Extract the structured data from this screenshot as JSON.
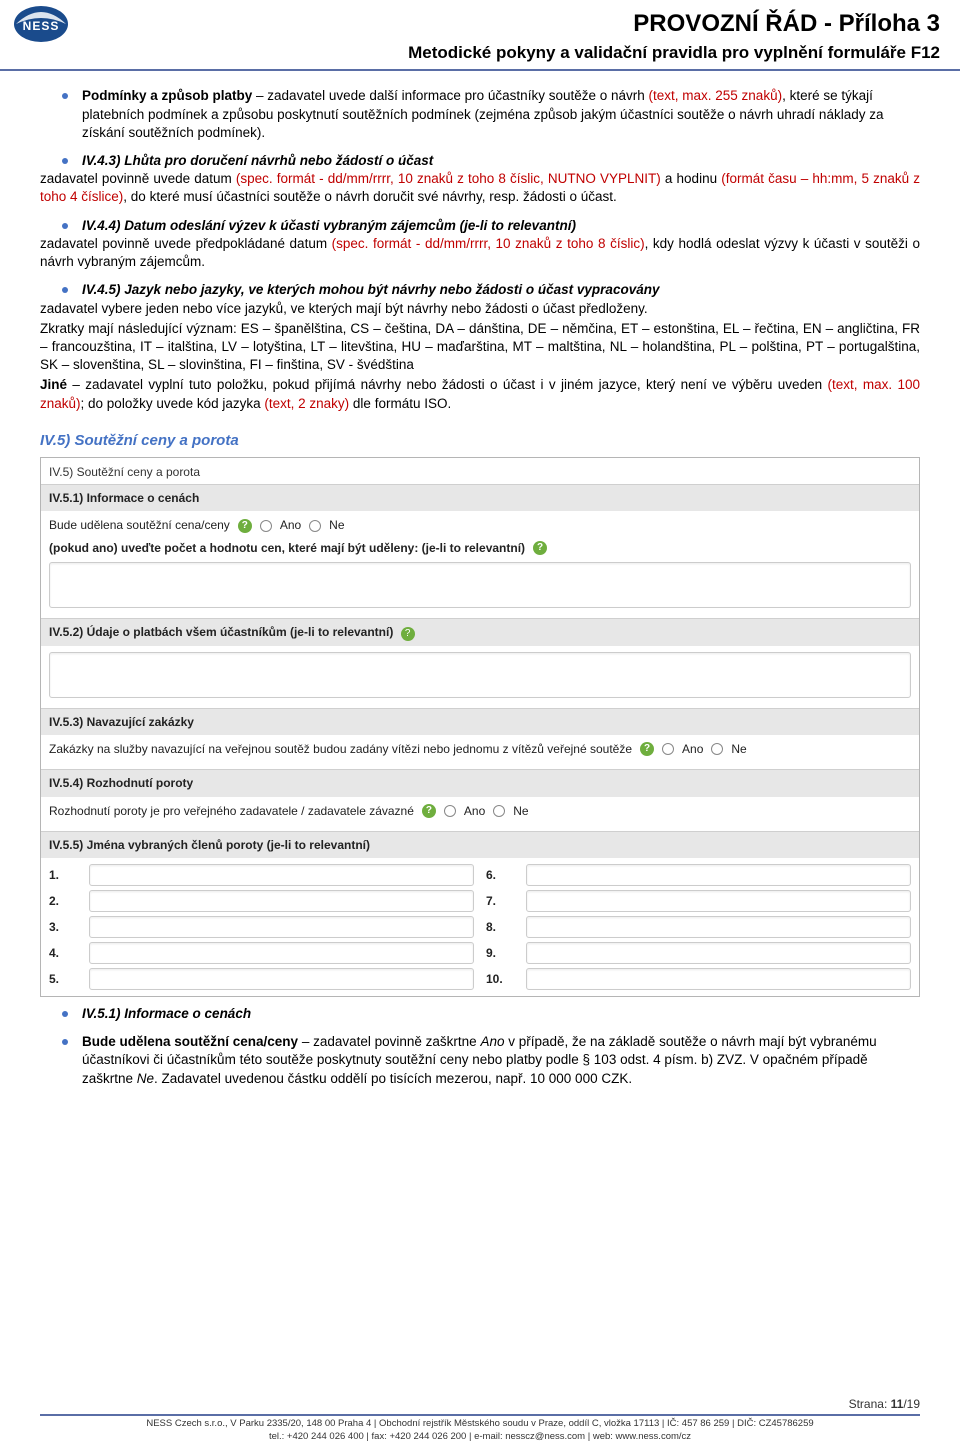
{
  "header": {
    "title": "PROVOZNÍ ŘÁD - Příloha 3",
    "subtitle": "Metodické pokyny a validační pravidla pro vyplnění formuláře F12"
  },
  "bullets_top": [
    {
      "head": "Podmínky a způsob platby",
      "text1": " – zadavatel uvede další informace pro účastníky soutěže o návrh ",
      "red1": "(text, max. 255 znaků)",
      "text2": ", které se týkají platebních podmínek a způsobu poskytnutí soutěžních podmínek (zejména způsob jakým účastníci soutěže o návrh uhradí náklady za získání soutěžních podmínek)."
    },
    {
      "head": "IV.4.3) Lhůta pro doručení návrhů nebo žádostí o účast",
      "plain1": "zadavatel povinně uvede datum ",
      "red1": "(spec. formát - dd/mm/rrrr, 10 znaků z toho 8 číslic, NUTNO VYPLNIT)",
      "plain2": " a hodinu ",
      "red2": "(formát času – hh:mm, 5 znaků z toho 4 číslice)",
      "plain3": ", do které musí účastníci soutěže o návrh doručit své návrhy, resp. žádosti o účast."
    },
    {
      "head": "IV.4.4) Datum odeslání výzev k účasti vybraným zájemcům (je-li to relevantní)",
      "plain1": "zadavatel povinně uvede předpokládané datum ",
      "red1": "(spec. formát - dd/mm/rrrr, 10 znaků z toho 8  číslic)",
      "plain2": ", kdy hodlá odeslat výzvy k účasti v soutěži o návrh vybraným zájemcům."
    },
    {
      "head": "IV.4.5) Jazyk nebo jazyky, ve kterých mohou být návrhy nebo žádosti o účast vypracovány",
      "plain1": "zadavatel vybere jeden nebo více jazyků, ve kterých mají být návrhy nebo žádosti o účast předloženy.",
      "plain2": "Zkratky mají následující význam: ES – španělština, CS – čeština, DA – dánština, DE – němčina, ET – estonština, EL – řečtina, EN – angličtina, FR – francouzština, IT – italština, LV – lotyština, LT – litevština, HU – maďarština, MT – maltština, NL – holandština, PL – polština, PT – portugalština, SK – slovenština, SL – slovinština, FI – finština, SV - švédština",
      "jine_head": "Jiné",
      "jine_text1": " – zadavatel vyplní tuto položku, pokud přijímá návrhy nebo žádosti o účast i v jiném jazyce, který není ve výběru uveden ",
      "jine_red1": "(text, max. 100 znaků)",
      "jine_text2": "; do položky uvede kód jazyka ",
      "jine_red2": "(text, 2 znaky)",
      "jine_text3": " dle formátu ISO."
    }
  ],
  "section_heading": "IV.5) Soutěžní ceny a porota",
  "screenshot": {
    "outer_title": "IV.5) Soutěžní ceny a porota",
    "h_51": "IV.5.1) Informace o cenách",
    "row_51_label": "Bude udělena soutěžní cena/ceny",
    "ano": "Ano",
    "ne": "Ne",
    "row_51b_label": "(pokud ano) uveďte počet a hodnotu cen, které mají být uděleny: (je-li to relevantní)",
    "h_52": "IV.5.2) Údaje o platbách všem účastníkům (je-li to relevantní)",
    "h_53": "IV.5.3) Navazující zakázky",
    "row_53_label": "Zakázky na služby navazující na veřejnou soutěž budou zadány vítězi nebo jednomu z vítězů veřejné soutěže",
    "h_54": "IV.5.4) Rozhodnutí poroty",
    "row_54_label": "Rozhodnutí poroty je pro veřejného zadavatele / zadavatele závazné",
    "h_55": "IV.5.5) Jména vybraných členů poroty (je-li to relevantní)",
    "nums_left": [
      "1.",
      "2.",
      "3.",
      "4.",
      "5."
    ],
    "nums_right": [
      "6.",
      "7.",
      "8.",
      "9.",
      "10."
    ]
  },
  "bullets_bottom": [
    {
      "head": "IV.5.1) Informace o cenách",
      "text": ""
    },
    {
      "head": "Bude udělena soutěžní cena/ceny",
      "text1": " – zadavatel povinně zaškrtne ",
      "i1": "Ano",
      "text2": " v případě, že na základě soutěže o návrh mají být vybranému účastníkovi či účastníkům této soutěže poskytnuty soutěžní ceny nebo platby podle § 103 odst. 4 písm. b) ZVZ. V opačném případě zaškrtne ",
      "i2": "Ne",
      "text3": ". Zadavatel uvedenou částku oddělí po tisících mezerou, např. 10 000 000 CZK."
    }
  ],
  "footer": {
    "strana_label": "Strana: ",
    "page": "11",
    "total": "/19",
    "line1": "NESS Czech s.r.o., V Parku 2335/20, 148 00 Praha 4 | Obchodní rejstřík Městského soudu v Praze, oddíl C, vložka 17113 | IČ: 457 86 259 | DIČ: CZ45786259",
    "line2": "tel.: +420 244 026 400 | fax: +420 244 026 200 | e-mail: nesscz@ness.com | web: www.ness.com/cz"
  }
}
